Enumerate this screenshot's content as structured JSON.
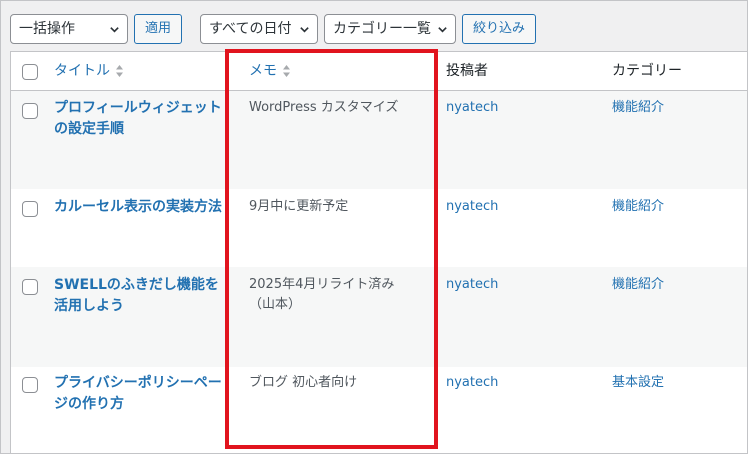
{
  "toolbar": {
    "bulk_action": "一括操作",
    "apply_label": "適用",
    "date_filter": "すべての日付",
    "category_filter": "カテゴリー一覧",
    "filter_label": "絞り込み"
  },
  "columns": {
    "title": "タイトル",
    "memo": "メモ",
    "author": "投稿者",
    "category": "カテゴリー"
  },
  "rows": [
    {
      "title": "プロフィールウィジェットの設定手順",
      "memo": "WordPress カスタマイズ",
      "author": "nyatech",
      "category": "機能紹介"
    },
    {
      "title": "カルーセル表示の実装方法",
      "memo": "9月中に更新予定",
      "author": "nyatech",
      "category": "機能紹介"
    },
    {
      "title": "SWELLのふきだし機能を活用しよう",
      "memo": "2025年4月リライト済み（山本）",
      "author": "nyatech",
      "category": "機能紹介"
    },
    {
      "title": "プライバシーポリシーページの作り方",
      "memo": "ブログ 初心者向け",
      "author": "nyatech",
      "category": "基本設定"
    }
  ],
  "colors": {
    "link": "#2271b1",
    "highlight": "#e1141e",
    "alt_row": "#f6f7f7"
  }
}
